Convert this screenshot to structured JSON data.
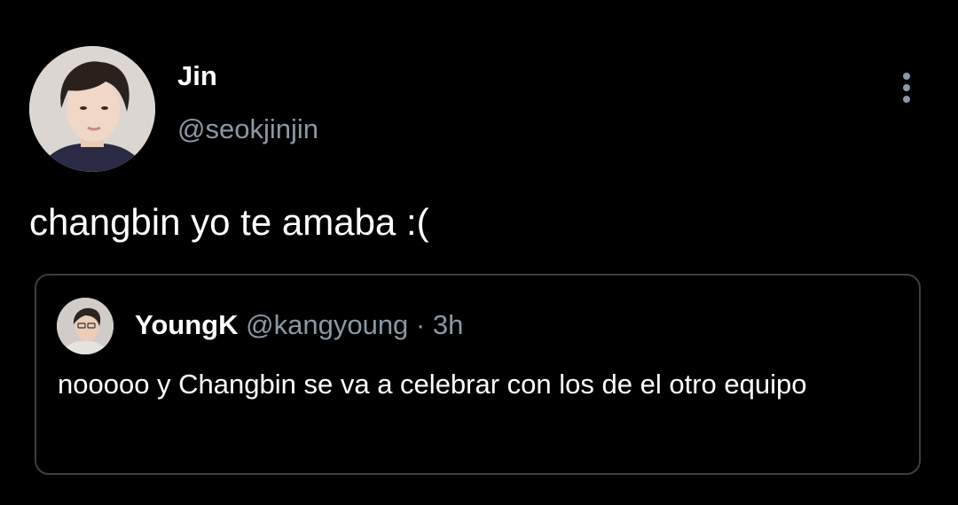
{
  "tweet": {
    "author": {
      "name": "Jin",
      "handle": "@seokjinjin",
      "avatar_icon": "user-avatar-photo"
    },
    "text": "changbin yo te amaba :(",
    "menu_icon": "more-vertical-icon",
    "quoted": {
      "author": {
        "name": "YoungK",
        "handle": "@kangyoung",
        "avatar_icon": "user-avatar-photo"
      },
      "separator": "·",
      "time": "3h",
      "text": "nooooo y Changbin se va a celebrar con los de el otro equipo"
    }
  },
  "colors": {
    "background": "#000000",
    "primary_text": "#ffffff",
    "secondary_text": "#8b98a5",
    "border": "#3a3f45"
  }
}
